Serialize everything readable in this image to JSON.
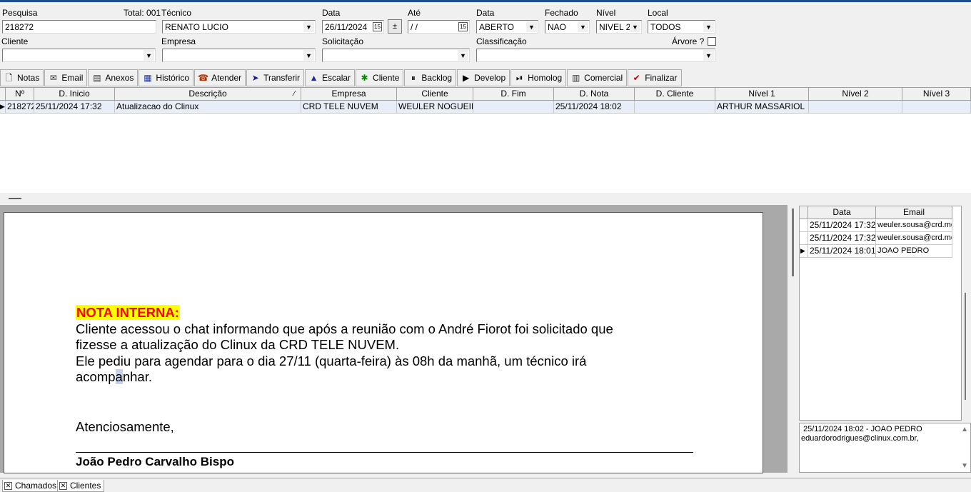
{
  "filters": {
    "pesquisa_label": "Pesquisa",
    "pesquisa_value": "218272",
    "total_label": "Total: 001",
    "tecnico_label": "Técnico",
    "tecnico_value": "RENATO LUCIO",
    "data_label": "Data",
    "data_value": "26/11/2024",
    "ate_label": "Até",
    "ate_value": "/  /",
    "data_status_label": "Data",
    "data_status_value": "ABERTO",
    "fechado_label": "Fechado",
    "fechado_value": "NAO",
    "nivel_label": "Nível",
    "nivel_value": "NIVEL 2",
    "local_label": "Local",
    "local_value": "TODOS",
    "cliente_label": "Cliente",
    "cliente_value": "",
    "empresa_label": "Empresa",
    "empresa_value": "",
    "solicitacao_label": "Solicitação",
    "solicitacao_value": "",
    "classificacao_label": "Classificação",
    "classificacao_value": "",
    "arvore_label": "Árvore ?"
  },
  "toolbar": [
    {
      "label": "Notas",
      "icon": "notes-icon",
      "glyph": "🗋",
      "color": "#000"
    },
    {
      "label": "Email",
      "icon": "email-icon",
      "glyph": "✉",
      "color": "#333"
    },
    {
      "label": "Anexos",
      "icon": "attachments-icon",
      "glyph": "▤",
      "color": "#333"
    },
    {
      "label": "Histórico",
      "icon": "history-icon",
      "glyph": "▦",
      "color": "#223399"
    },
    {
      "label": "Atender",
      "icon": "phone-icon",
      "glyph": "☎",
      "color": "#b03000"
    },
    {
      "label": "Transferir",
      "icon": "transfer-icon",
      "glyph": "➤",
      "color": "#1a1a9a"
    },
    {
      "label": "Escalar",
      "icon": "escalate-icon",
      "glyph": "▲",
      "color": "#1a2a9a"
    },
    {
      "label": "Cliente",
      "icon": "client-icon",
      "glyph": "✱",
      "color": "#008800"
    },
    {
      "label": "Backlog",
      "icon": "backlog-icon",
      "glyph": "⏸",
      "color": "#000"
    },
    {
      "label": "Develop",
      "icon": "develop-icon",
      "glyph": "▶",
      "color": "#000"
    },
    {
      "label": "Homolog",
      "icon": "homolog-icon",
      "glyph": "⏯",
      "color": "#000"
    },
    {
      "label": "Comercial",
      "icon": "calculator-icon",
      "glyph": "▥",
      "color": "#333"
    },
    {
      "label": "Finalizar",
      "icon": "checkmark-icon",
      "glyph": "✔",
      "color": "#cc0000"
    }
  ],
  "grid": {
    "headers": [
      "Nº",
      "D. Inicio",
      "Descrição",
      "Empresa",
      "Cliente",
      "D. Fim",
      "D. Nota",
      "D. Cliente",
      "Nível 1",
      "Nível 2",
      "Nível 3"
    ],
    "sort_marker": "⁄",
    "row": {
      "numero": "218272",
      "d_inicio": "25/11/2024 17:32",
      "descricao": "Atualizacao do Clinux",
      "empresa": "CRD TELE NUVEM",
      "cliente": "WEULER NOGUEIRA",
      "d_fim": "",
      "d_nota": "25/11/2024 18:02",
      "d_cliente": "",
      "nivel1": "ARTHUR MASSARIOL",
      "nivel2": "",
      "nivel3": ""
    }
  },
  "document": {
    "heading": "NOTA INTERNA:",
    "line1": "Cliente acessou o chat informando que após a reunião com o André Fiorot foi solicitado que",
    "line2": "fizesse a atualização do Clinux da CRD TELE NUVEM.",
    "line3": "Ele pediu para agendar para o dia 27/11 (quarta-feira) às 08h da manhã, um técnico irá",
    "line4_a": "acomp",
    "line4_b": "a",
    "line4_c": "nhar.",
    "closing": "Atenciosamente,",
    "signature": "João Pedro Carvalho Bispo"
  },
  "email_grid": {
    "headers": [
      "Data",
      "Email"
    ],
    "rows": [
      {
        "data": "25/11/2024 17:32",
        "email": "weuler.sousa@crd.me"
      },
      {
        "data": "25/11/2024 17:32",
        "email": "weuler.sousa@crd.me"
      },
      {
        "data": "25/11/2024 18:01",
        "email": "JOAO PEDRO"
      }
    ]
  },
  "memo": {
    "line1": "25/11/2024 18:02 - JOAO PEDRO",
    "line2": "eduardorodrigues@clinux.com.br,"
  },
  "bottom_tabs": [
    "Chamados",
    "Clientes"
  ]
}
